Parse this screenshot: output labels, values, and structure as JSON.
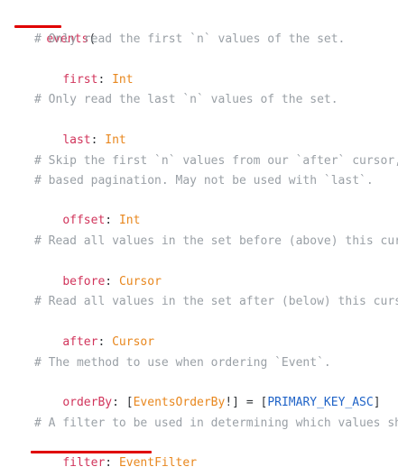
{
  "code": {
    "header": {
      "name": "events",
      "open_paren": "("
    },
    "blocks": [
      {
        "comment_lines": [
          "# Only read the first `n` values of the set."
        ],
        "field": "first",
        "colon": ": ",
        "type": "Int"
      },
      {
        "comment_lines": [
          "# Only read the last `n` values of the set."
        ],
        "field": "last",
        "colon": ": ",
        "type": "Int"
      },
      {
        "comment_lines": [
          "# Skip the first `n` values from our `after` cursor, an alternative to cursor",
          "# based pagination. May not be used with `last`."
        ],
        "field": "offset",
        "colon": ": ",
        "type": "Int"
      },
      {
        "comment_lines": [
          "# Read all values in the set before (above) this cursor."
        ],
        "field": "before",
        "colon": ": ",
        "type": "Cursor"
      },
      {
        "comment_lines": [
          "# Read all values in the set after (below) this cursor."
        ],
        "field": "after",
        "colon": ": ",
        "type": "Cursor"
      },
      {
        "comment_lines": [
          "# The method to use when ordering `Event`."
        ],
        "field": "orderBy",
        "colon": ": ",
        "type_open": "[",
        "type": "EventsOrderBy",
        "type_close": "!]",
        "equals": " = ",
        "default_open": "[",
        "default_value": "PRIMARY_KEY_ASC",
        "default_close": "]"
      },
      {
        "comment_lines": [
          "# A filter to be used in determining which values should be returned by the collection."
        ],
        "field": "filter",
        "colon": ": ",
        "type": "EventFilter"
      }
    ]
  },
  "colors": {
    "comment": "#9aa0a6",
    "field": "#d1345b",
    "type": "#e8871e",
    "enum": "#1f63c7",
    "underline": "#e00000"
  }
}
